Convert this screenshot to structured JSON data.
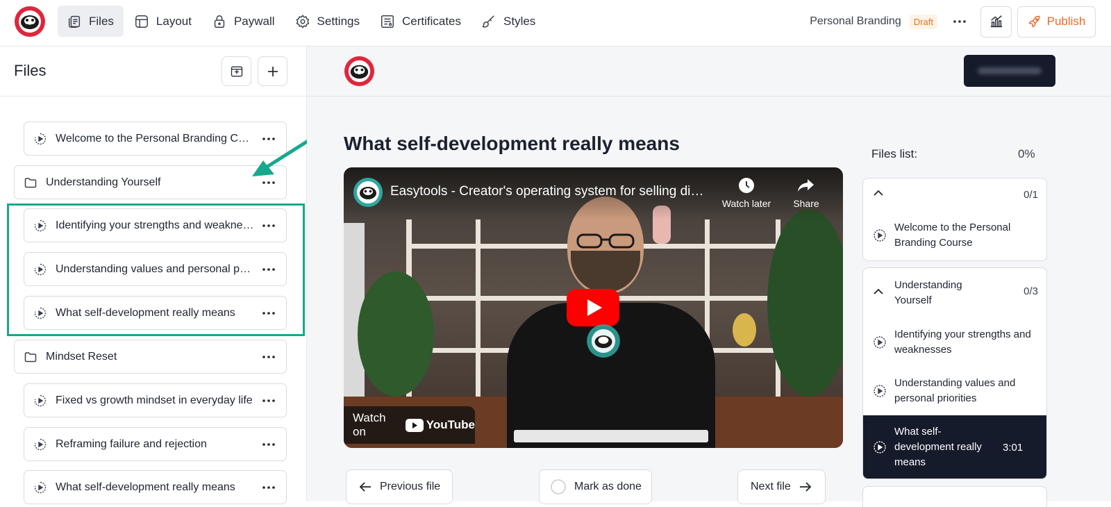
{
  "topbar": {
    "nav": [
      {
        "label": "Files",
        "icon": "files-icon",
        "active": true
      },
      {
        "label": "Layout",
        "icon": "layout-icon"
      },
      {
        "label": "Paywall",
        "icon": "lock-icon"
      },
      {
        "label": "Settings",
        "icon": "gear-icon"
      },
      {
        "label": "Certificates",
        "icon": "certificate-icon"
      },
      {
        "label": "Styles",
        "icon": "brush-icon"
      }
    ],
    "course_name": "Personal Branding",
    "status_badge": "Draft",
    "publish_label": "Publish",
    "colors": {
      "publish": "#ea6a2c",
      "brand_red": "#e0263d"
    }
  },
  "sidebar": {
    "title": "Files",
    "items": [
      {
        "type": "file",
        "label": "Welcome to the Personal Branding Course"
      },
      {
        "type": "folder",
        "label": "Understanding Yourself"
      },
      {
        "type": "file",
        "label": "Identifying your strengths and weaknesses"
      },
      {
        "type": "file",
        "label": "Understanding values and personal priorities"
      },
      {
        "type": "file",
        "label": "What self-development really means"
      },
      {
        "type": "folder",
        "label": "Mindset Reset"
      },
      {
        "type": "file",
        "label": "Fixed vs growth mindset in everyday life"
      },
      {
        "type": "file",
        "label": "Reframing failure and rejection"
      },
      {
        "type": "file",
        "label": "What self-development really means"
      }
    ],
    "highlight_color": "#17a88d"
  },
  "preview": {
    "lesson_title": "What self-development really means",
    "video": {
      "title": "Easytools - Creator's operating system for selling digital products",
      "watch_later": "Watch later",
      "share": "Share",
      "watch_on": "Watch on",
      "youtube": "YouTube"
    },
    "prev_label": "Previous file",
    "mark_done_label": "Mark as done",
    "next_label": "Next file"
  },
  "files_list": {
    "title": "Files list:",
    "progress": "0%",
    "sections": [
      {
        "count": "0/1",
        "items": [
          {
            "label": "Welcome to the Personal Branding Course"
          }
        ]
      },
      {
        "title": "Understanding Yourself",
        "count": "0/3",
        "items": [
          {
            "label": "Identifying your strengths and weaknesses"
          },
          {
            "label": "Understanding values and personal priorities"
          },
          {
            "label": "What self-development really means",
            "duration": "3:01",
            "active": true
          }
        ]
      }
    ]
  }
}
